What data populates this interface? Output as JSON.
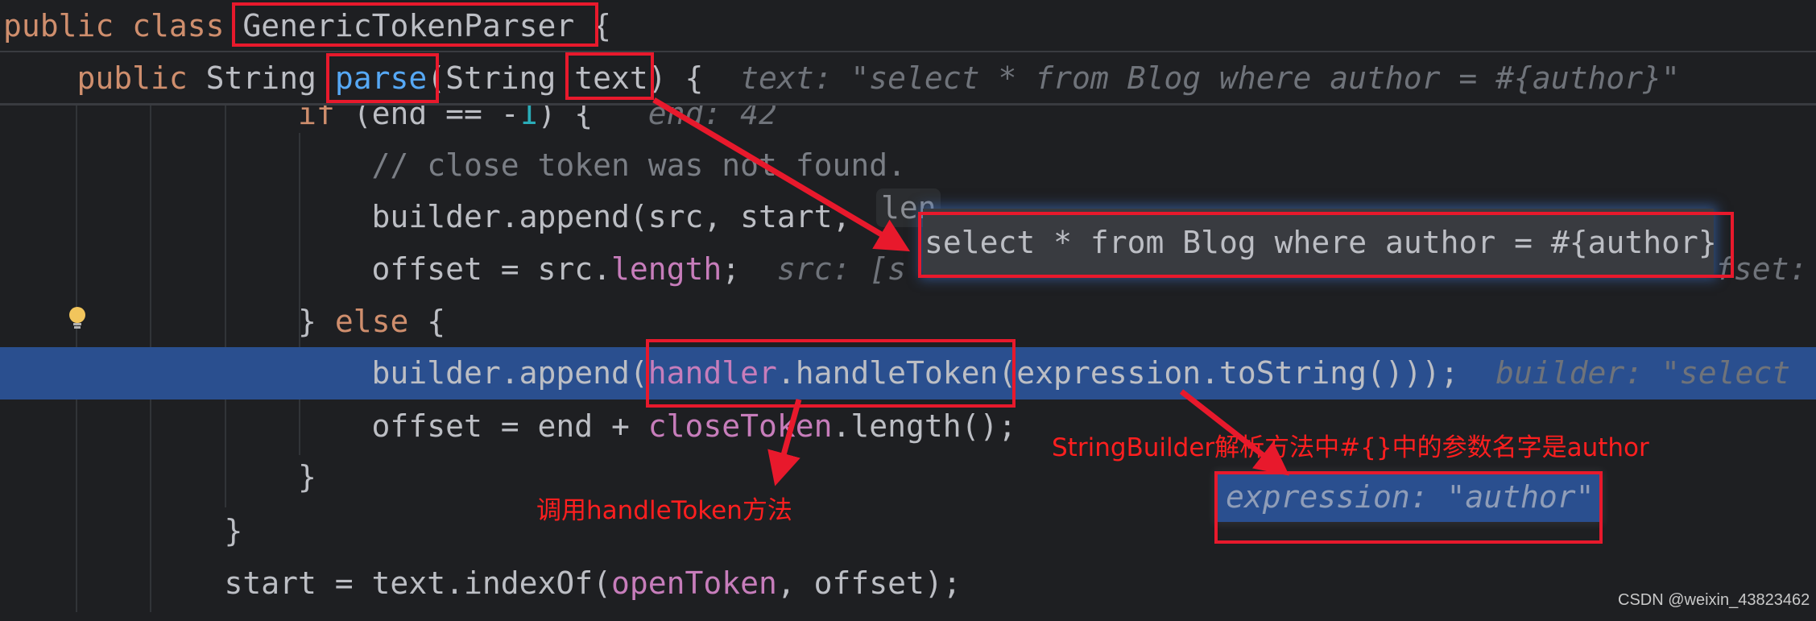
{
  "editor": {
    "sticky_lines": [
      [
        {
          "t": "public class ",
          "c": "kw"
        },
        {
          "t": "GenericTokenParser {",
          "c": ""
        }
      ],
      [
        {
          "t": "    public ",
          "c": "kw"
        },
        {
          "t": "String ",
          "c": ""
        },
        {
          "t": "parse",
          "c": "fn"
        },
        {
          "t": "(String text) {",
          "c": ""
        },
        {
          "t": "  text: \"select * from Blog where author = #{author}\"",
          "c": "hint"
        }
      ]
    ],
    "lines": [
      [
        {
          "t": "                if ",
          "c": "kw"
        },
        {
          "t": "(end == -",
          "c": ""
        },
        {
          "t": "1",
          "c": "num"
        },
        {
          "t": ") {",
          "c": ""
        },
        {
          "t": "   end: 42",
          "c": "hint"
        }
      ],
      [
        {
          "t": "                    // close token was not found.",
          "c": "cm"
        }
      ],
      [
        {
          "t": "                    builder.append(src, start, ",
          "c": ""
        }
      ],
      [
        {
          "t": "                    offset = src.",
          "c": ""
        },
        {
          "t": "length",
          "c": "fld"
        },
        {
          "t": ";",
          "c": ""
        },
        {
          "t": "  src: [s",
          "c": "hint"
        }
      ],
      [
        {
          "t": "                } ",
          "c": ""
        },
        {
          "t": "else",
          "c": "kw"
        },
        {
          "t": " {",
          "c": ""
        }
      ],
      [
        {
          "t": "                    builder.append(",
          "c": ""
        },
        {
          "t": "handler",
          "c": "fld"
        },
        {
          "t": ".handleToken(expression.toString()));",
          "c": ""
        },
        {
          "t": "  builder: \"select",
          "c": "hint"
        }
      ],
      [
        {
          "t": "                    offset = end + ",
          "c": ""
        },
        {
          "t": "closeToken",
          "c": "fld"
        },
        {
          "t": ".length();",
          "c": ""
        }
      ],
      [
        {
          "t": "                }",
          "c": ""
        }
      ],
      [
        {
          "t": "            }",
          "c": ""
        }
      ],
      [
        {
          "t": "            start = text.indexOf(",
          "c": ""
        },
        {
          "t": "openToken",
          "c": "fld"
        },
        {
          "t": ", offset);",
          "c": ""
        }
      ]
    ],
    "len_chip": "len",
    "offset_hint_tail": "fset:",
    "popup_value": "select * from Blog where author = #{author}",
    "expression_hint": "expression: \"author\"",
    "highlight_color": "#2a4f8f",
    "bulb_icon": "lightbulb-icon"
  },
  "annotations": {
    "call_note": "调用handleToken方法",
    "param_note": "StringBuilder解析方法中#{}中的参数名字是author",
    "color": "#e8192c"
  },
  "watermark": "CSDN @weixin_43823462"
}
